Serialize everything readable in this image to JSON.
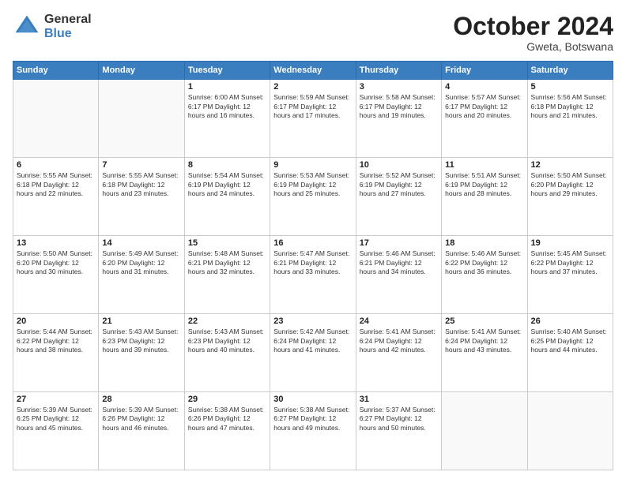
{
  "logo": {
    "general": "General",
    "blue": "Blue"
  },
  "header": {
    "month": "October 2024",
    "location": "Gweta, Botswana"
  },
  "weekdays": [
    "Sunday",
    "Monday",
    "Tuesday",
    "Wednesday",
    "Thursday",
    "Friday",
    "Saturday"
  ],
  "weeks": [
    [
      {
        "day": "",
        "info": ""
      },
      {
        "day": "",
        "info": ""
      },
      {
        "day": "1",
        "info": "Sunrise: 6:00 AM\nSunset: 6:17 PM\nDaylight: 12 hours\nand 16 minutes."
      },
      {
        "day": "2",
        "info": "Sunrise: 5:59 AM\nSunset: 6:17 PM\nDaylight: 12 hours\nand 17 minutes."
      },
      {
        "day": "3",
        "info": "Sunrise: 5:58 AM\nSunset: 6:17 PM\nDaylight: 12 hours\nand 19 minutes."
      },
      {
        "day": "4",
        "info": "Sunrise: 5:57 AM\nSunset: 6:17 PM\nDaylight: 12 hours\nand 20 minutes."
      },
      {
        "day": "5",
        "info": "Sunrise: 5:56 AM\nSunset: 6:18 PM\nDaylight: 12 hours\nand 21 minutes."
      }
    ],
    [
      {
        "day": "6",
        "info": "Sunrise: 5:55 AM\nSunset: 6:18 PM\nDaylight: 12 hours\nand 22 minutes."
      },
      {
        "day": "7",
        "info": "Sunrise: 5:55 AM\nSunset: 6:18 PM\nDaylight: 12 hours\nand 23 minutes."
      },
      {
        "day": "8",
        "info": "Sunrise: 5:54 AM\nSunset: 6:19 PM\nDaylight: 12 hours\nand 24 minutes."
      },
      {
        "day": "9",
        "info": "Sunrise: 5:53 AM\nSunset: 6:19 PM\nDaylight: 12 hours\nand 25 minutes."
      },
      {
        "day": "10",
        "info": "Sunrise: 5:52 AM\nSunset: 6:19 PM\nDaylight: 12 hours\nand 27 minutes."
      },
      {
        "day": "11",
        "info": "Sunrise: 5:51 AM\nSunset: 6:19 PM\nDaylight: 12 hours\nand 28 minutes."
      },
      {
        "day": "12",
        "info": "Sunrise: 5:50 AM\nSunset: 6:20 PM\nDaylight: 12 hours\nand 29 minutes."
      }
    ],
    [
      {
        "day": "13",
        "info": "Sunrise: 5:50 AM\nSunset: 6:20 PM\nDaylight: 12 hours\nand 30 minutes."
      },
      {
        "day": "14",
        "info": "Sunrise: 5:49 AM\nSunset: 6:20 PM\nDaylight: 12 hours\nand 31 minutes."
      },
      {
        "day": "15",
        "info": "Sunrise: 5:48 AM\nSunset: 6:21 PM\nDaylight: 12 hours\nand 32 minutes."
      },
      {
        "day": "16",
        "info": "Sunrise: 5:47 AM\nSunset: 6:21 PM\nDaylight: 12 hours\nand 33 minutes."
      },
      {
        "day": "17",
        "info": "Sunrise: 5:46 AM\nSunset: 6:21 PM\nDaylight: 12 hours\nand 34 minutes."
      },
      {
        "day": "18",
        "info": "Sunrise: 5:46 AM\nSunset: 6:22 PM\nDaylight: 12 hours\nand 36 minutes."
      },
      {
        "day": "19",
        "info": "Sunrise: 5:45 AM\nSunset: 6:22 PM\nDaylight: 12 hours\nand 37 minutes."
      }
    ],
    [
      {
        "day": "20",
        "info": "Sunrise: 5:44 AM\nSunset: 6:22 PM\nDaylight: 12 hours\nand 38 minutes."
      },
      {
        "day": "21",
        "info": "Sunrise: 5:43 AM\nSunset: 6:23 PM\nDaylight: 12 hours\nand 39 minutes."
      },
      {
        "day": "22",
        "info": "Sunrise: 5:43 AM\nSunset: 6:23 PM\nDaylight: 12 hours\nand 40 minutes."
      },
      {
        "day": "23",
        "info": "Sunrise: 5:42 AM\nSunset: 6:24 PM\nDaylight: 12 hours\nand 41 minutes."
      },
      {
        "day": "24",
        "info": "Sunrise: 5:41 AM\nSunset: 6:24 PM\nDaylight: 12 hours\nand 42 minutes."
      },
      {
        "day": "25",
        "info": "Sunrise: 5:41 AM\nSunset: 6:24 PM\nDaylight: 12 hours\nand 43 minutes."
      },
      {
        "day": "26",
        "info": "Sunrise: 5:40 AM\nSunset: 6:25 PM\nDaylight: 12 hours\nand 44 minutes."
      }
    ],
    [
      {
        "day": "27",
        "info": "Sunrise: 5:39 AM\nSunset: 6:25 PM\nDaylight: 12 hours\nand 45 minutes."
      },
      {
        "day": "28",
        "info": "Sunrise: 5:39 AM\nSunset: 6:26 PM\nDaylight: 12 hours\nand 46 minutes."
      },
      {
        "day": "29",
        "info": "Sunrise: 5:38 AM\nSunset: 6:26 PM\nDaylight: 12 hours\nand 47 minutes."
      },
      {
        "day": "30",
        "info": "Sunrise: 5:38 AM\nSunset: 6:27 PM\nDaylight: 12 hours\nand 49 minutes."
      },
      {
        "day": "31",
        "info": "Sunrise: 5:37 AM\nSunset: 6:27 PM\nDaylight: 12 hours\nand 50 minutes."
      },
      {
        "day": "",
        "info": ""
      },
      {
        "day": "",
        "info": ""
      }
    ]
  ]
}
